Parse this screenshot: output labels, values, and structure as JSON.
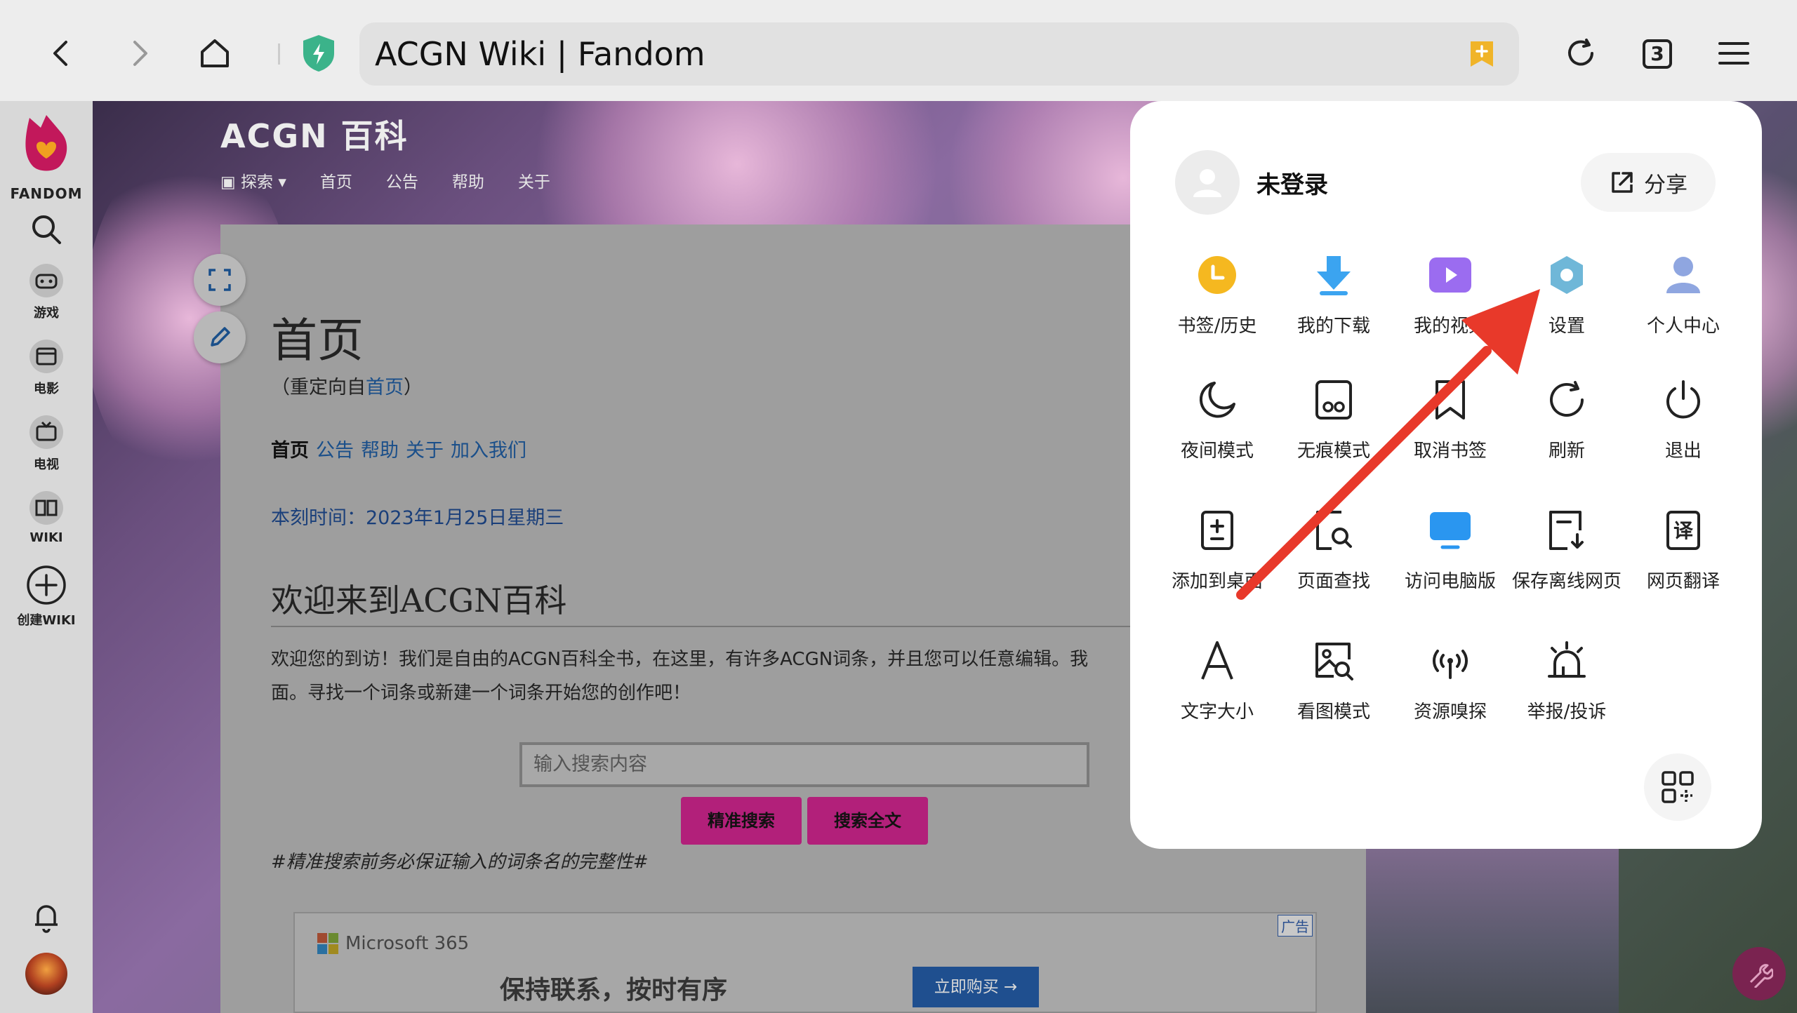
{
  "toolbar": {
    "page_title": "ACGN Wiki | Fandom",
    "tab_count": "3"
  },
  "fandom_rail": {
    "brand": "FANDOM",
    "items": [
      {
        "label": ""
      },
      {
        "label": "游戏"
      },
      {
        "label": "电影"
      },
      {
        "label": "电视"
      },
      {
        "label": "WIKI"
      },
      {
        "label": "创建WIKI"
      }
    ]
  },
  "wiki": {
    "name": "ACGN 百科",
    "nav": [
      "探索",
      "首页",
      "公告",
      "帮助",
      "关于"
    ]
  },
  "article": {
    "title": "首页",
    "redirect_prefix": "（重定向自",
    "redirect_link": "首页",
    "redirect_suffix": "）",
    "links_bold": "首页",
    "links": [
      "公告",
      "帮助",
      "关于",
      "加入我们"
    ],
    "time": "本刻时间：2023年1月25日星期三",
    "welcome": "欢迎来到ACGN百科",
    "desc_line1": "欢迎您的到访！我们是自由的ACGN百科全书，在这里，有许多ACGN词条，并且您可以任意编辑。我",
    "desc_line2": "面。寻找一个词条或新建一个词条开始您的创作吧！",
    "search_placeholder": "输入搜索内容",
    "btn_exact": "精准搜索",
    "btn_full": "搜索全文",
    "note": "#精准搜索前务必保证输入的词条名的完整性#"
  },
  "ad": {
    "brand": "Microsoft 365",
    "slogan": "保持联系，按时有序",
    "buy": "立即购买 →",
    "tag": "广告"
  },
  "menu": {
    "user": "未登录",
    "share": "分享",
    "colors": {
      "bookmark": "#f5b820",
      "download": "#3ba4f0",
      "video": "#9b6cf0",
      "settings": "#6fb7d8",
      "user": "#8fa6e0",
      "pc": "#2a96f0",
      "arrow": "#e8392a"
    },
    "items": [
      {
        "label": "书签/历史",
        "icon": "bookmark-history-icon"
      },
      {
        "label": "我的下载",
        "icon": "download-icon"
      },
      {
        "label": "我的视频",
        "icon": "video-icon"
      },
      {
        "label": "设置",
        "icon": "settings-icon"
      },
      {
        "label": "个人中心",
        "icon": "user-center-icon"
      },
      {
        "label": "夜间模式",
        "icon": "moon-icon"
      },
      {
        "label": "无痕模式",
        "icon": "incognito-icon"
      },
      {
        "label": "取消书签",
        "icon": "bookmark-remove-icon"
      },
      {
        "label": "刷新",
        "icon": "refresh-icon"
      },
      {
        "label": "退出",
        "icon": "power-icon"
      },
      {
        "label": "添加到桌面",
        "icon": "add-desktop-icon"
      },
      {
        "label": "页面查找",
        "icon": "find-in-page-icon"
      },
      {
        "label": "访问电脑版",
        "icon": "desktop-site-icon"
      },
      {
        "label": "保存离线网页",
        "icon": "save-offline-icon"
      },
      {
        "label": "网页翻译",
        "icon": "translate-icon"
      },
      {
        "label": "文字大小",
        "icon": "text-size-icon"
      },
      {
        "label": "看图模式",
        "icon": "image-mode-icon"
      },
      {
        "label": "资源嗅探",
        "icon": "resource-sniff-icon"
      },
      {
        "label": "举报/投诉",
        "icon": "report-icon"
      }
    ]
  }
}
